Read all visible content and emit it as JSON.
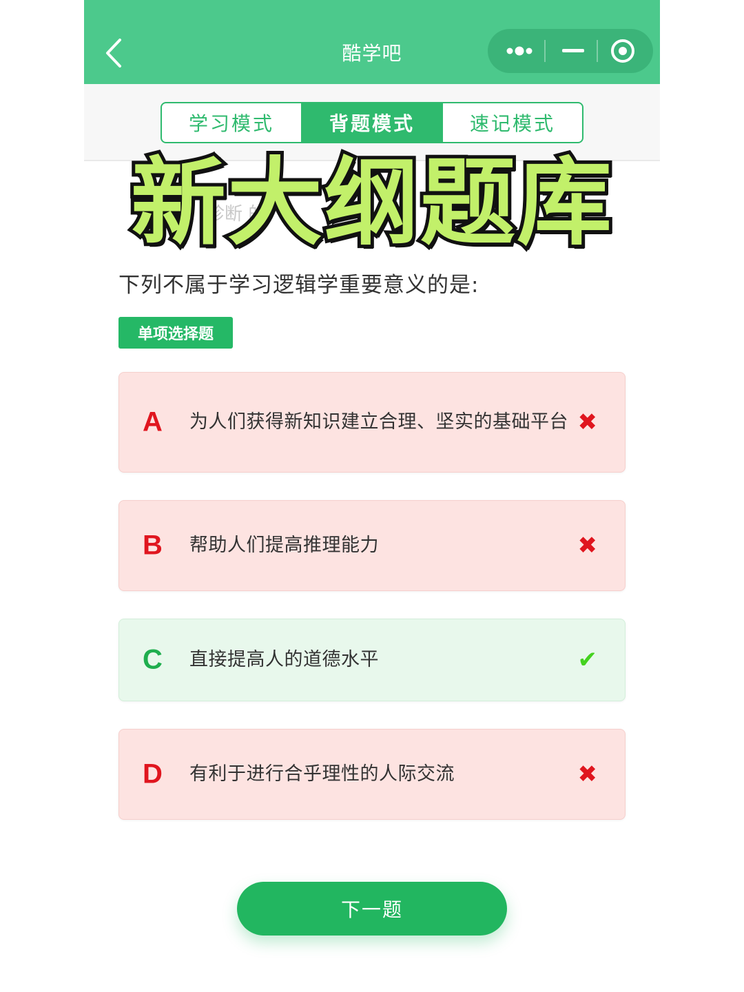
{
  "header": {
    "title": "酷学吧"
  },
  "tabs": [
    {
      "label": "学习模式",
      "active": false
    },
    {
      "label": "背题模式",
      "active": true
    },
    {
      "label": "速记模式",
      "active": false
    }
  ],
  "overlay": {
    "title": "新大纲题库",
    "obscured_text": "诊断   的"
  },
  "question": {
    "text": "下列不属于学习逻辑学重要意义的是:",
    "type_badge": "单项选择题"
  },
  "options": [
    {
      "letter": "A",
      "text": "为人们获得新知识建立合理、坚实的基础平台",
      "correct": false,
      "mark": "✖"
    },
    {
      "letter": "B",
      "text": "帮助人们提高推理能力",
      "correct": false,
      "mark": "✖"
    },
    {
      "letter": "C",
      "text": "直接提高人的道德水平",
      "correct": true,
      "mark": "✔"
    },
    {
      "letter": "D",
      "text": "有利于进行合乎理性的人际交流",
      "correct": false,
      "mark": "✖"
    }
  ],
  "footer": {
    "next_label": "下一题"
  },
  "colors": {
    "header_green": "#4cc98c",
    "accent_green": "#2fba6e",
    "wrong_red": "#e0161f",
    "right_green": "#1fae4e"
  }
}
